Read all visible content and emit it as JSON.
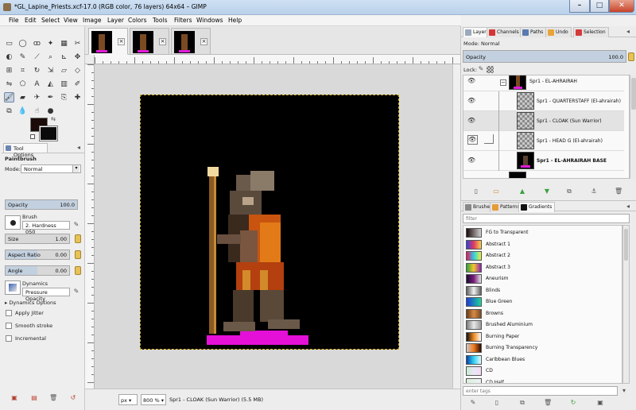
{
  "window": {
    "title": "*GL_Lapine_Priests.xcf-17.0 (RGB color, 76 layers) 64x64 – GIMP"
  },
  "menubar": [
    "File",
    "Edit",
    "Select",
    "View",
    "Image",
    "Layer",
    "Colors",
    "Tools",
    "Filters",
    "Windows",
    "Help"
  ],
  "tool_options": {
    "tab_label": "Tool Options",
    "tool_name": "Paintbrush",
    "mode_label": "Mode:",
    "mode_value": "Normal",
    "opacity_label": "Opacity",
    "opacity_value": "100.0",
    "opacity_fraction": 1.0,
    "brush_label": "Brush",
    "brush_value": "2. Hardness 050",
    "size_label": "Size",
    "size_value": "1.00",
    "aspect_label": "Aspect Ratio",
    "aspect_value": "0.00",
    "angle_label": "Angle",
    "angle_value": "0.00",
    "dynamics_label": "Dynamics",
    "dynamics_value": "Pressure Opacity",
    "dynamics_options": "Dynamics Options",
    "apply_jitter": "Apply Jitter",
    "smooth_stroke": "Smooth stroke",
    "incremental": "Incremental"
  },
  "status": {
    "unit": "px",
    "zoom": "800 %",
    "message": "Spr1 - CLOAK (Sun Warrior) (5.5 MB)"
  },
  "layers_dock": {
    "tabs": [
      "Layers",
      "Channels",
      "Paths",
      "Undo",
      "Selection"
    ],
    "mode_label": "Mode: Normal",
    "opacity_label": "Opacity",
    "opacity_value": "100.0",
    "lock_label": "Lock:",
    "layers": [
      {
        "name": "Spr1 - EL-AHRAIRAH",
        "bold": false
      },
      {
        "name": "Spr1 - QUARTERSTAFF (El-ahrairah)",
        "bold": false
      },
      {
        "name": "Spr1 - CLOAK (Sun Warrior)",
        "bold": false
      },
      {
        "name": "Spr1 - HEAD G (El-ahrairah)",
        "bold": false
      },
      {
        "name": "Spr1 - EL-AHRAIRAH BASE",
        "bold": true
      }
    ]
  },
  "gradients_dock": {
    "tabs": [
      "Brushes",
      "Patterns",
      "Gradients"
    ],
    "filter_placeholder": "filter",
    "tags_placeholder": "enter tags",
    "items": [
      {
        "name": "FG to Transparent",
        "colors": [
          "#1a0b08",
          "#d0d0d0"
        ]
      },
      {
        "name": "Abstract 1",
        "colors": [
          "#3340d8",
          "#e23a62",
          "#f5d24a"
        ]
      },
      {
        "name": "Abstract 2",
        "colors": [
          "#e8145c",
          "#2ad1e6",
          "#f1ef3b"
        ]
      },
      {
        "name": "Abstract 3",
        "colors": [
          "#2fa03d",
          "#f7c52c",
          "#8b1fb4"
        ]
      },
      {
        "name": "Aneurism",
        "colors": [
          "#1b0935",
          "#7a1c7a",
          "#e4e4e4"
        ]
      },
      {
        "name": "Blinds",
        "colors": [
          "#606060",
          "#f0f0f0",
          "#606060"
        ]
      },
      {
        "name": "Blue Green",
        "colors": [
          "#1d3bd4",
          "#1fd39b"
        ]
      },
      {
        "name": "Browns",
        "colors": [
          "#6b3a17",
          "#d68b45",
          "#7a4a22"
        ]
      },
      {
        "name": "Brushed Aluminium",
        "colors": [
          "#7a7a7a",
          "#e8e8e8",
          "#9a9a9a"
        ]
      },
      {
        "name": "Burning Paper",
        "colors": [
          "#111111",
          "#f28b1f",
          "#ffffff"
        ]
      },
      {
        "name": "Burning Transparency",
        "colors": [
          "#c9c9c9",
          "#f27a1f",
          "#2a0a00"
        ]
      },
      {
        "name": "Caribbean Blues",
        "colors": [
          "#0c3fa8",
          "#2ed3f2",
          "#e8f8ff"
        ]
      },
      {
        "name": "CD",
        "colors": [
          "#c8ecd0",
          "#e8e8f8",
          "#f8d8f0"
        ]
      },
      {
        "name": "CD Half",
        "colors": [
          "#d8f0d8",
          "#f0f0f8"
        ]
      }
    ]
  }
}
